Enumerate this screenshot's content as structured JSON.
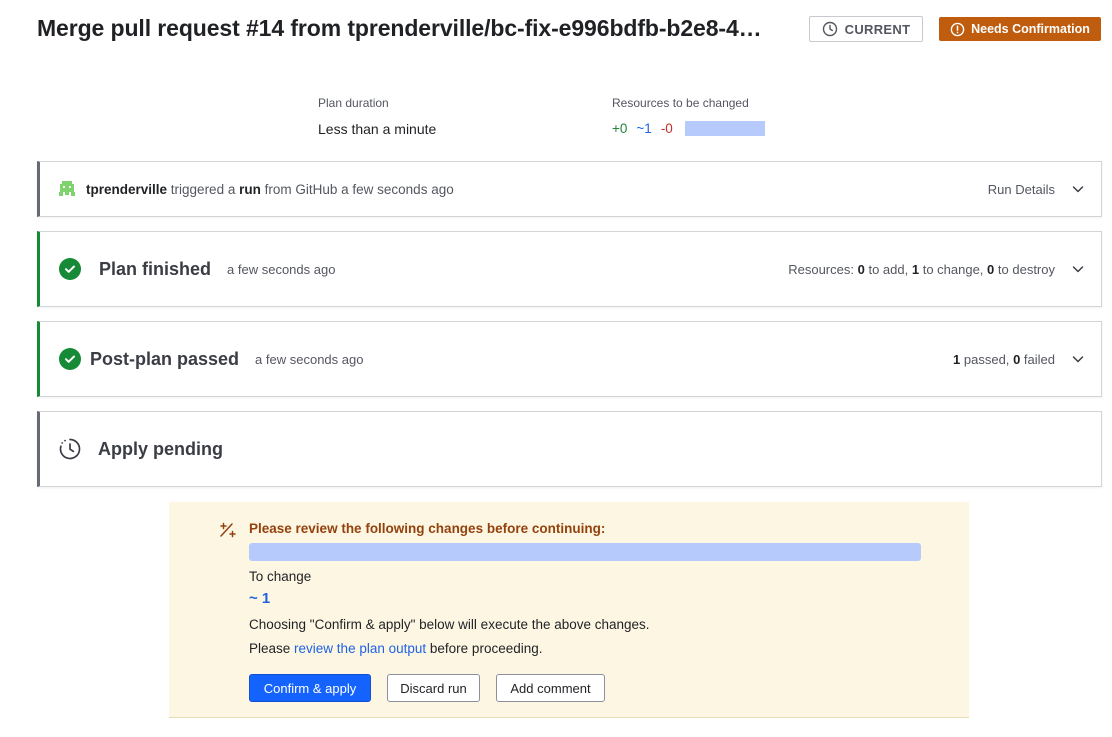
{
  "header": {
    "title": "Merge pull request #14 from tprenderville/bc-fix-e996bdfb-b2e8-4…",
    "current_badge": "CURRENT",
    "status_badge": "Needs Confirmation"
  },
  "summary": {
    "plan_duration_label": "Plan duration",
    "plan_duration_value": "Less than a minute",
    "resources_label": "Resources to be changed",
    "add": "+0",
    "change": "~1",
    "destroy": "-0"
  },
  "trigger": {
    "user": "tprenderville",
    "text1": "triggered a",
    "run_word": "run",
    "text2": "from GitHub a few seconds ago",
    "details_label": "Run Details"
  },
  "plan": {
    "title": "Plan finished",
    "time": "a few seconds ago",
    "res_prefix": "Resources:",
    "add_count": "0",
    "add_text": "to add,",
    "change_count": "1",
    "change_text": "to change,",
    "destroy_count": "0",
    "destroy_text": "to destroy"
  },
  "post_plan": {
    "title": "Post-plan passed",
    "time": "a few seconds ago",
    "passed_count": "1",
    "passed_text": "passed,",
    "failed_count": "0",
    "failed_text": "failed"
  },
  "apply": {
    "title": "Apply pending"
  },
  "notice": {
    "heading": "Please review the following changes before continuing:",
    "to_change_label": "To change",
    "to_change_value": "~ 1",
    "line1": "Choosing \"Confirm & apply\" below will execute the above changes.",
    "line2_pre": "Please",
    "line2_link": "review the plan output",
    "line2_post": "before proceeding.",
    "confirm_button": "Confirm & apply",
    "discard_button": "Discard run",
    "comment_button": "Add comment"
  },
  "colors": {
    "success": "#168a36",
    "warning_badge": "#c05c0e",
    "primary": "#1563ff",
    "notice_bg": "#fdf6e3"
  }
}
